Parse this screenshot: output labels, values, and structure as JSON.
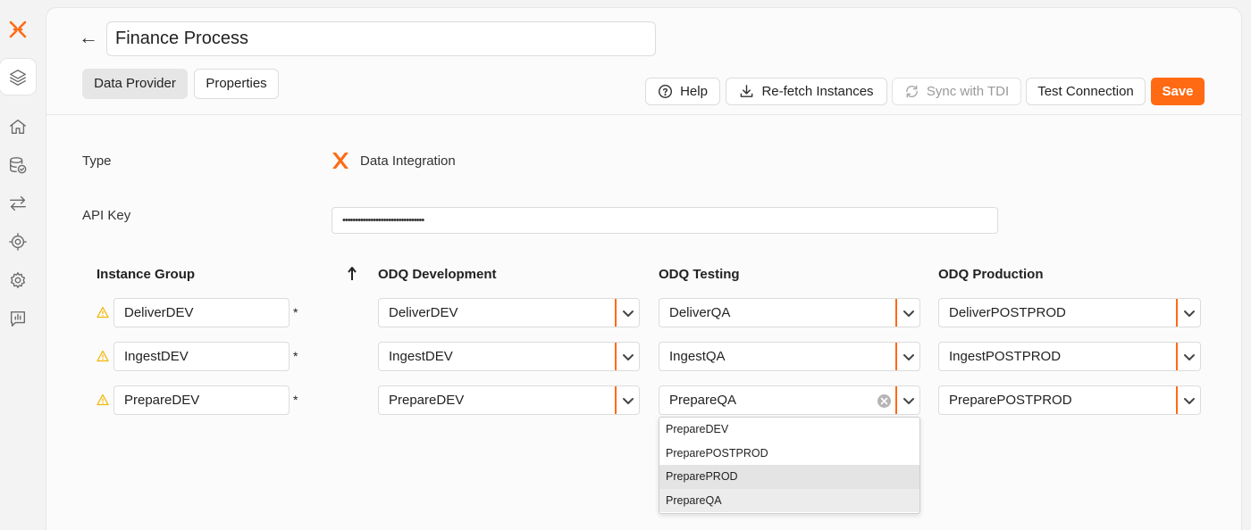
{
  "header": {
    "title": "Finance Process",
    "back_label": "←"
  },
  "tabs": [
    {
      "label": "Data Provider",
      "active": true
    },
    {
      "label": "Properties",
      "active": false
    }
  ],
  "toolbar": {
    "help": "Help",
    "refetch": "Re-fetch Instances",
    "sync": "Sync with TDI",
    "test": "Test Connection",
    "save": "Save"
  },
  "form": {
    "type_label": "Type",
    "type_value": "Data Integration",
    "api_key_label": "API Key",
    "api_key_value": "••••••••••••••••••••••••••••••••"
  },
  "table": {
    "headers": [
      "Instance Group",
      "ODQ Development",
      "ODQ Testing",
      "ODQ Production"
    ],
    "rows": [
      {
        "group": "DeliverDEV",
        "required": "*",
        "dev": "DeliverDEV",
        "test": "DeliverQA",
        "prod": "DeliverPOSTPROD"
      },
      {
        "group": "IngestDEV",
        "required": "*",
        "dev": "IngestDEV",
        "test": "IngestQA",
        "prod": "IngestPOSTPROD"
      },
      {
        "group": "PrepareDEV",
        "required": "*",
        "dev": "PrepareDEV",
        "test": "PrepareQA",
        "prod": "PreparePOSTPROD"
      }
    ]
  },
  "dropdown": {
    "options": [
      "PrepareDEV",
      "PreparePOSTPROD",
      "PreparePROD",
      "PrepareQA"
    ],
    "hovered": "PreparePROD",
    "selected": "PrepareQA"
  },
  "colors": {
    "accent": "#ff6a13",
    "warning": "#f2b705"
  },
  "sidebar": {
    "icons": [
      "layers-icon",
      "home-icon",
      "database-check-icon",
      "transfer-icon",
      "target-gear-icon",
      "settings-cog-icon",
      "chart-message-icon"
    ]
  }
}
